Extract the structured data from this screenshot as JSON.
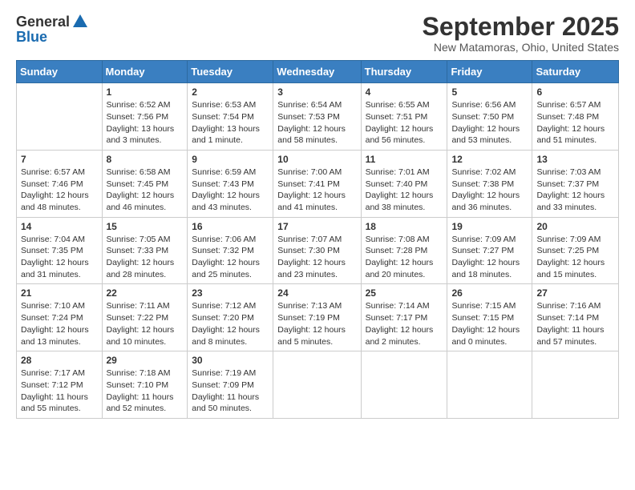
{
  "logo": {
    "general": "General",
    "blue": "Blue"
  },
  "title": "September 2025",
  "location": "New Matamoras, Ohio, United States",
  "headers": [
    "Sunday",
    "Monday",
    "Tuesday",
    "Wednesday",
    "Thursday",
    "Friday",
    "Saturday"
  ],
  "weeks": [
    [
      {
        "day": "",
        "info": ""
      },
      {
        "day": "1",
        "info": "Sunrise: 6:52 AM\nSunset: 7:56 PM\nDaylight: 13 hours\nand 3 minutes."
      },
      {
        "day": "2",
        "info": "Sunrise: 6:53 AM\nSunset: 7:54 PM\nDaylight: 13 hours\nand 1 minute."
      },
      {
        "day": "3",
        "info": "Sunrise: 6:54 AM\nSunset: 7:53 PM\nDaylight: 12 hours\nand 58 minutes."
      },
      {
        "day": "4",
        "info": "Sunrise: 6:55 AM\nSunset: 7:51 PM\nDaylight: 12 hours\nand 56 minutes."
      },
      {
        "day": "5",
        "info": "Sunrise: 6:56 AM\nSunset: 7:50 PM\nDaylight: 12 hours\nand 53 minutes."
      },
      {
        "day": "6",
        "info": "Sunrise: 6:57 AM\nSunset: 7:48 PM\nDaylight: 12 hours\nand 51 minutes."
      }
    ],
    [
      {
        "day": "7",
        "info": "Sunrise: 6:57 AM\nSunset: 7:46 PM\nDaylight: 12 hours\nand 48 minutes."
      },
      {
        "day": "8",
        "info": "Sunrise: 6:58 AM\nSunset: 7:45 PM\nDaylight: 12 hours\nand 46 minutes."
      },
      {
        "day": "9",
        "info": "Sunrise: 6:59 AM\nSunset: 7:43 PM\nDaylight: 12 hours\nand 43 minutes."
      },
      {
        "day": "10",
        "info": "Sunrise: 7:00 AM\nSunset: 7:41 PM\nDaylight: 12 hours\nand 41 minutes."
      },
      {
        "day": "11",
        "info": "Sunrise: 7:01 AM\nSunset: 7:40 PM\nDaylight: 12 hours\nand 38 minutes."
      },
      {
        "day": "12",
        "info": "Sunrise: 7:02 AM\nSunset: 7:38 PM\nDaylight: 12 hours\nand 36 minutes."
      },
      {
        "day": "13",
        "info": "Sunrise: 7:03 AM\nSunset: 7:37 PM\nDaylight: 12 hours\nand 33 minutes."
      }
    ],
    [
      {
        "day": "14",
        "info": "Sunrise: 7:04 AM\nSunset: 7:35 PM\nDaylight: 12 hours\nand 31 minutes."
      },
      {
        "day": "15",
        "info": "Sunrise: 7:05 AM\nSunset: 7:33 PM\nDaylight: 12 hours\nand 28 minutes."
      },
      {
        "day": "16",
        "info": "Sunrise: 7:06 AM\nSunset: 7:32 PM\nDaylight: 12 hours\nand 25 minutes."
      },
      {
        "day": "17",
        "info": "Sunrise: 7:07 AM\nSunset: 7:30 PM\nDaylight: 12 hours\nand 23 minutes."
      },
      {
        "day": "18",
        "info": "Sunrise: 7:08 AM\nSunset: 7:28 PM\nDaylight: 12 hours\nand 20 minutes."
      },
      {
        "day": "19",
        "info": "Sunrise: 7:09 AM\nSunset: 7:27 PM\nDaylight: 12 hours\nand 18 minutes."
      },
      {
        "day": "20",
        "info": "Sunrise: 7:09 AM\nSunset: 7:25 PM\nDaylight: 12 hours\nand 15 minutes."
      }
    ],
    [
      {
        "day": "21",
        "info": "Sunrise: 7:10 AM\nSunset: 7:24 PM\nDaylight: 12 hours\nand 13 minutes."
      },
      {
        "day": "22",
        "info": "Sunrise: 7:11 AM\nSunset: 7:22 PM\nDaylight: 12 hours\nand 10 minutes."
      },
      {
        "day": "23",
        "info": "Sunrise: 7:12 AM\nSunset: 7:20 PM\nDaylight: 12 hours\nand 8 minutes."
      },
      {
        "day": "24",
        "info": "Sunrise: 7:13 AM\nSunset: 7:19 PM\nDaylight: 12 hours\nand 5 minutes."
      },
      {
        "day": "25",
        "info": "Sunrise: 7:14 AM\nSunset: 7:17 PM\nDaylight: 12 hours\nand 2 minutes."
      },
      {
        "day": "26",
        "info": "Sunrise: 7:15 AM\nSunset: 7:15 PM\nDaylight: 12 hours\nand 0 minutes."
      },
      {
        "day": "27",
        "info": "Sunrise: 7:16 AM\nSunset: 7:14 PM\nDaylight: 11 hours\nand 57 minutes."
      }
    ],
    [
      {
        "day": "28",
        "info": "Sunrise: 7:17 AM\nSunset: 7:12 PM\nDaylight: 11 hours\nand 55 minutes."
      },
      {
        "day": "29",
        "info": "Sunrise: 7:18 AM\nSunset: 7:10 PM\nDaylight: 11 hours\nand 52 minutes."
      },
      {
        "day": "30",
        "info": "Sunrise: 7:19 AM\nSunset: 7:09 PM\nDaylight: 11 hours\nand 50 minutes."
      },
      {
        "day": "",
        "info": ""
      },
      {
        "day": "",
        "info": ""
      },
      {
        "day": "",
        "info": ""
      },
      {
        "day": "",
        "info": ""
      }
    ]
  ]
}
